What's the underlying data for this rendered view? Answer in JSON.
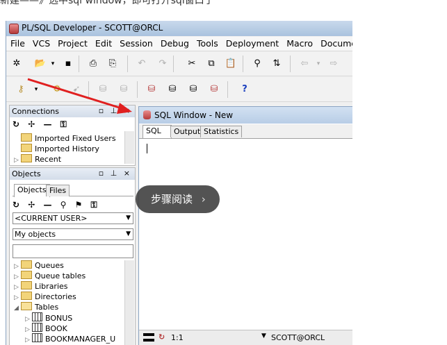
{
  "caption": "新建——》选中sql window，即可打开sql窗口了",
  "app": {
    "title": "PL/SQL Developer - SCOTT@ORCL",
    "menu": [
      "File",
      "VCS",
      "Project",
      "Edit",
      "Session",
      "Debug",
      "Tools",
      "Deployment",
      "Macro",
      "Docume"
    ]
  },
  "connections": {
    "title": "Connections",
    "controls": "▫ ⊥ ×",
    "tools": "↻ ✢ — ⚿",
    "items": [
      {
        "label": "Imported Fixed Users"
      },
      {
        "label": "Imported History"
      },
      {
        "label": "Recent"
      }
    ]
  },
  "objects": {
    "title": "Objects",
    "controls": "▫ ⊥ ×",
    "tabs": [
      "Objects",
      "Files"
    ],
    "tools": "↻ ✢ — ⚲ ⚑ ⚿",
    "user_combo": "<CURRENT USER>",
    "filter_combo": "My objects",
    "tree": [
      {
        "label": "Queues",
        "icon": "folder",
        "level": 0
      },
      {
        "label": "Queue tables",
        "icon": "folder",
        "level": 0
      },
      {
        "label": "Libraries",
        "icon": "folder",
        "level": 0
      },
      {
        "label": "Directories",
        "icon": "folder",
        "level": 0
      },
      {
        "label": "Tables",
        "icon": "folder-open",
        "level": 0
      },
      {
        "label": "BONUS",
        "icon": "table",
        "level": 1
      },
      {
        "label": "BOOK",
        "icon": "table",
        "level": 1
      },
      {
        "label": "BOOKMANAGER_U",
        "icon": "table",
        "level": 1
      }
    ]
  },
  "sql_window": {
    "title": "SQL Window - New",
    "tabs": [
      "SQL",
      "Output",
      "Statistics"
    ],
    "status_position": "1:1",
    "status_connection": "SCOTT@ORCL"
  },
  "overlay": {
    "label": "步骤阅读",
    "chevron": "›"
  },
  "colors": {
    "titlebar": "#b8cde6",
    "arrow": "#e02020"
  }
}
